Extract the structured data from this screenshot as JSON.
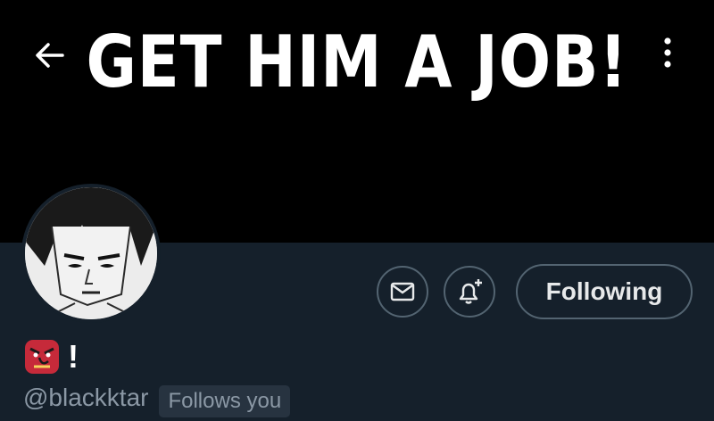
{
  "banner": {
    "text": "GET HIM A JOB!"
  },
  "header": {
    "back_icon": "arrow-left-icon",
    "more_icon": "more-vertical-icon"
  },
  "actions": {
    "message_icon": "envelope-icon",
    "notify_icon": "bell-plus-icon",
    "following_label": "Following"
  },
  "profile": {
    "display_name_emoji": "goblin-mask-emoji",
    "display_name_text": "!",
    "handle": "@blackktar",
    "follows_you_label": "Follows you"
  },
  "colors": {
    "background": "#15202b",
    "banner": "#000000",
    "button_border": "#536471",
    "secondary_text": "#8b98a5",
    "badge_bg": "#273340"
  }
}
